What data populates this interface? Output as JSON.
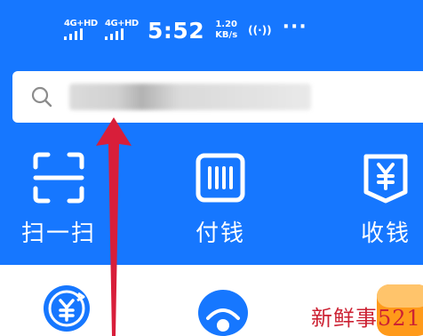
{
  "colors": {
    "brand_blue": "#1677ff",
    "white": "#ffffff",
    "arrow_red": "#d81e3a",
    "watermark_red": "#cc2233",
    "icon_orange": "#ff8a00"
  },
  "status_bar": {
    "sim1_label": "4G+HD",
    "sim2_label": "4G+HD",
    "time": "5:52",
    "speed_value": "1.20",
    "speed_unit": "KB/s",
    "hotspot_icon": "hotspot-icon",
    "more_icon": "more-dots-icon"
  },
  "search": {
    "icon": "search-icon",
    "placeholder_blurred": true
  },
  "quick_actions": [
    {
      "label": "扫一扫",
      "icon": "scan-icon"
    },
    {
      "label": "付钱",
      "icon": "pay-code-icon"
    },
    {
      "label": "收钱",
      "icon": "collect-money-icon"
    }
  ],
  "lower_icons": [
    {
      "icon": "yuan-refresh-icon"
    },
    {
      "icon": "shell-icon"
    },
    {
      "icon": "orange-app-icon"
    }
  ],
  "overlays": {
    "arrow_icon": "red-up-arrow-icon",
    "watermark": "新鲜事521"
  }
}
